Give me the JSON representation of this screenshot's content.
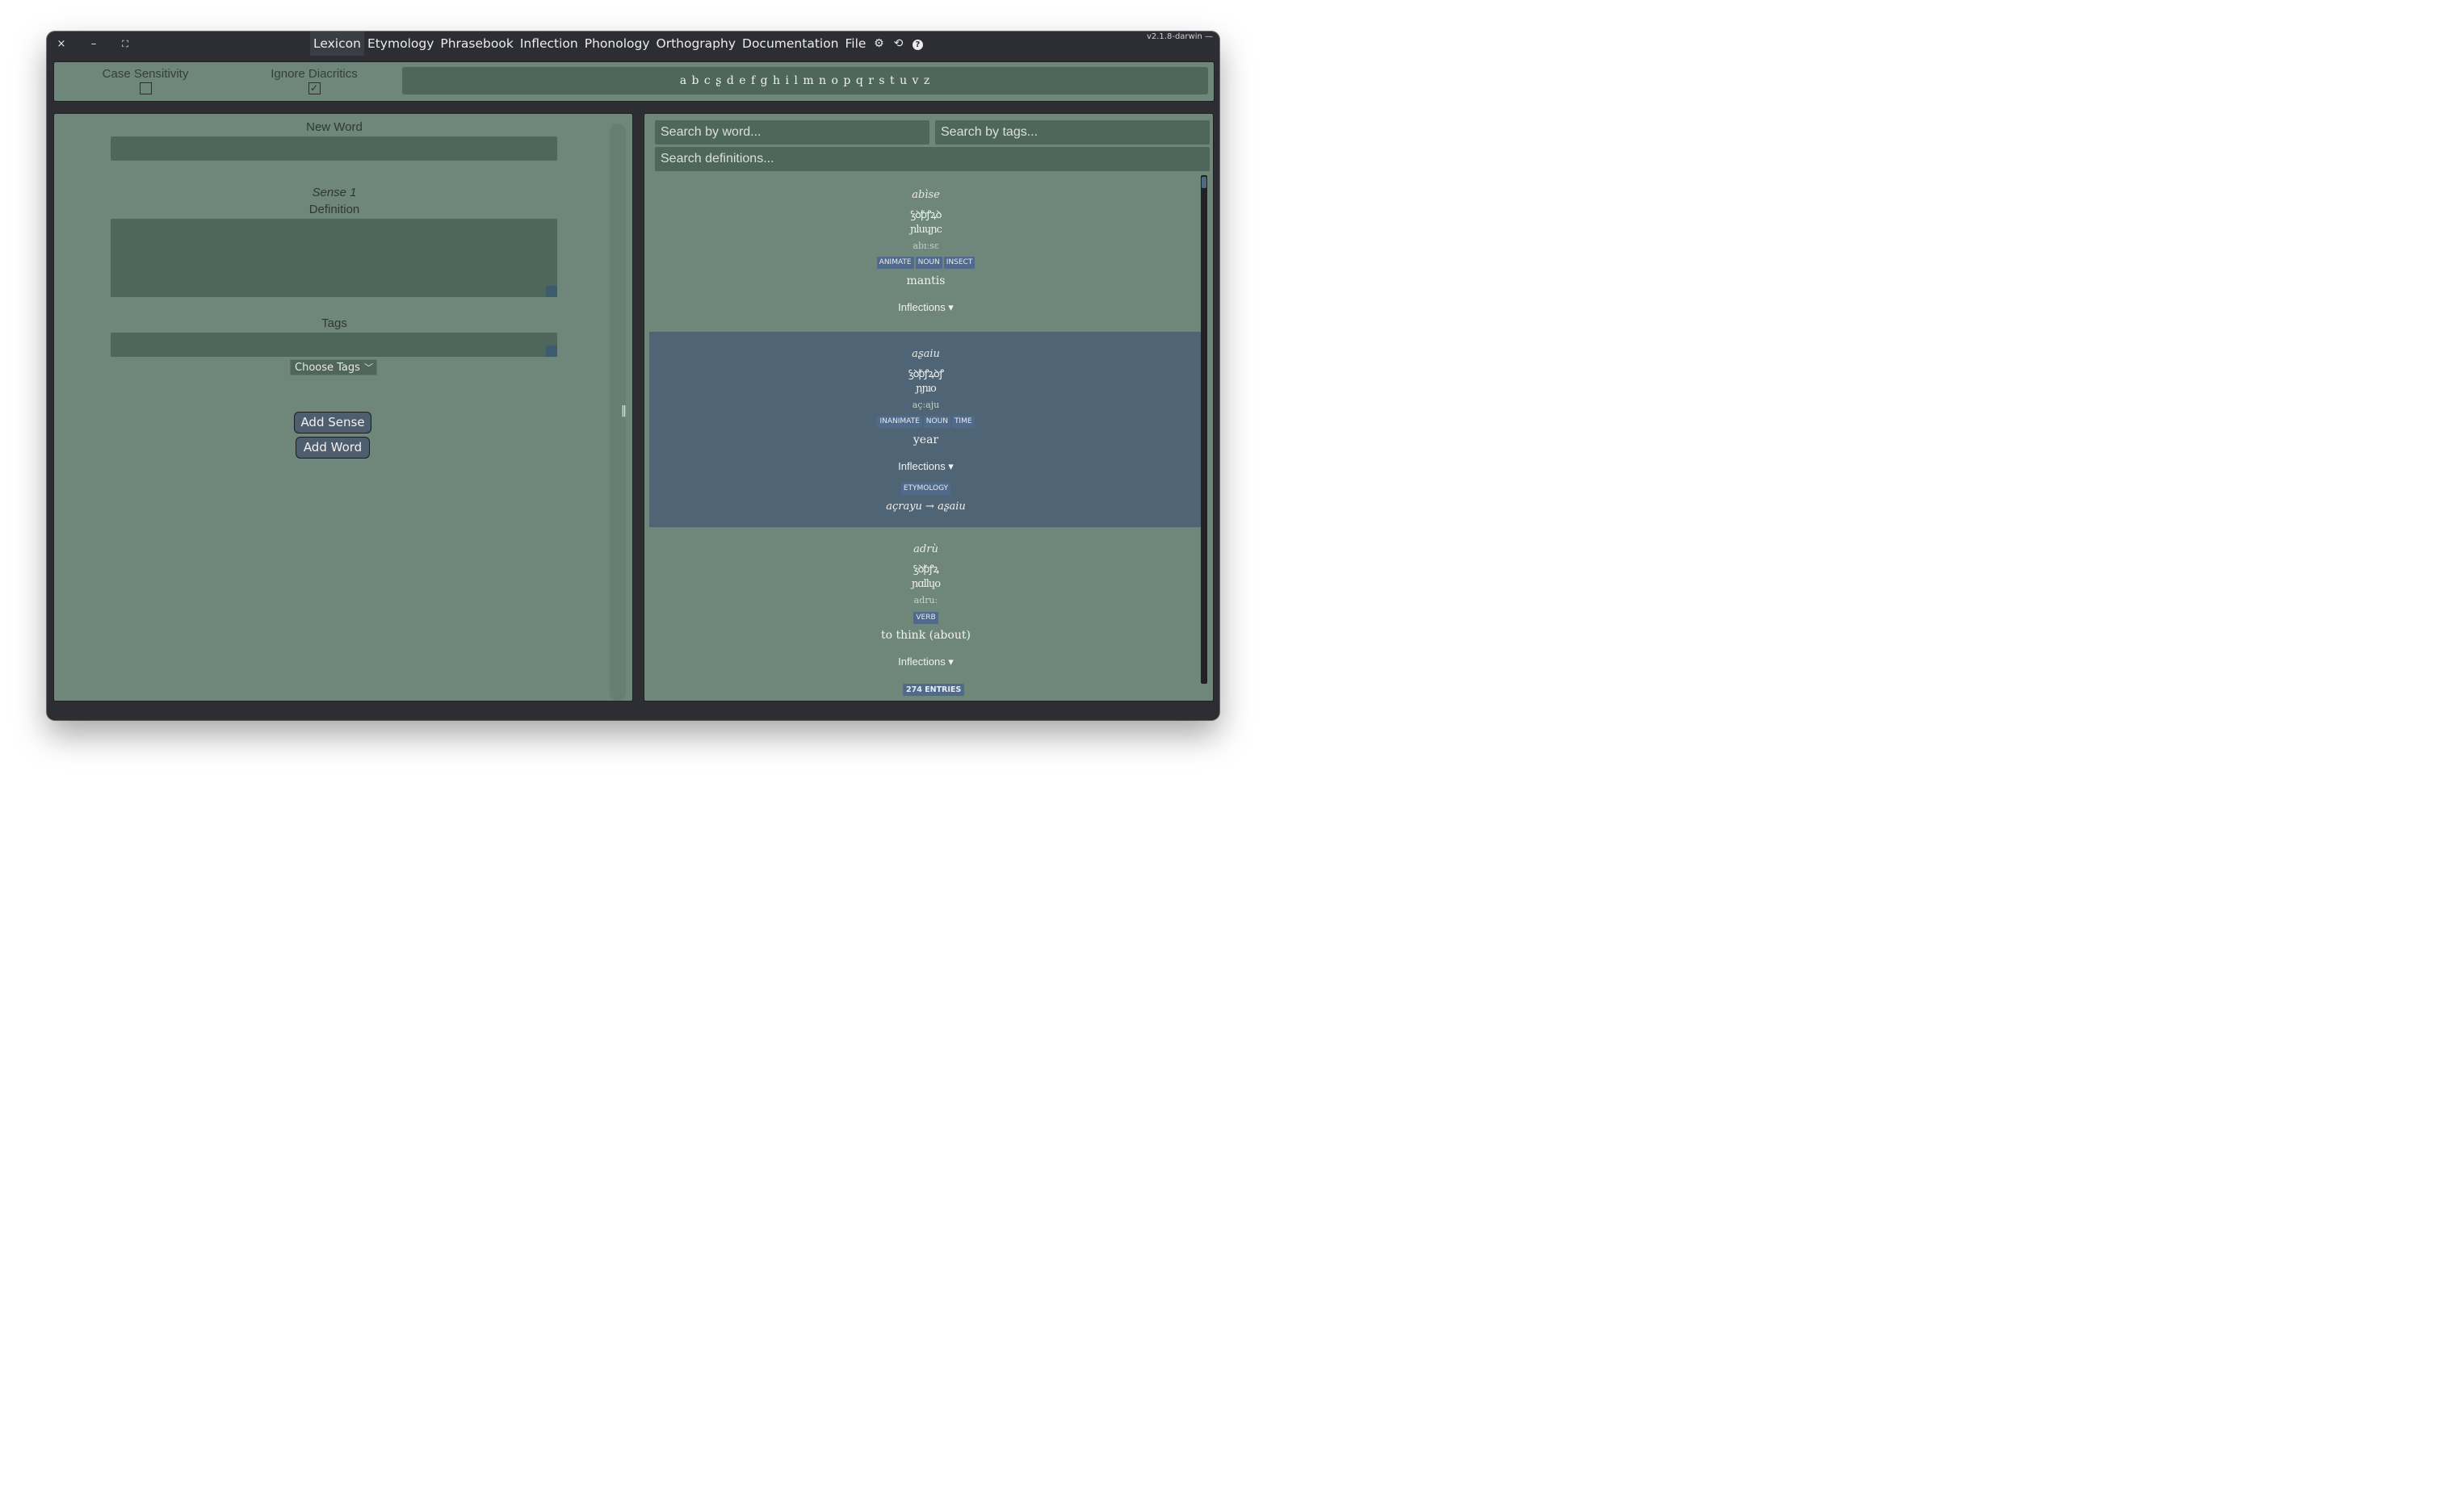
{
  "window": {
    "close_icon": "×",
    "minimize_icon": "–",
    "maximize_icon": "⛶",
    "version": "v2.1.8-darwin —"
  },
  "menu": {
    "items": [
      "Lexicon",
      "Etymology",
      "Phrasebook",
      "Inflection",
      "Phonology",
      "Orthography",
      "Documentation",
      "File"
    ],
    "active": "Lexicon",
    "settings_icon": "⚙",
    "history_icon": "⟲",
    "help_icon": "?"
  },
  "toolbar": {
    "case_sensitivity_label": "Case Sensitivity",
    "case_sensitivity_checked": false,
    "ignore_diacritics_label": "Ignore Diacritics",
    "ignore_diacritics_checked": true,
    "check_glyph": "✓",
    "alphabet": "a b c ʂ d e f g h i l m n o p q r s t u v z"
  },
  "editor": {
    "new_word_label": "New Word",
    "sense_label": "Sense 1",
    "definition_label": "Definition",
    "tags_label": "Tags",
    "choose_tags": "Choose Tags",
    "add_sense_button": "Add Sense",
    "add_word_button": "Add Word",
    "divider_handle": "‖"
  },
  "search": {
    "word_placeholder": "Search by word...",
    "tags_placeholder": "Search by tags...",
    "definitions_placeholder": "Search definitions..."
  },
  "entries": [
    {
      "word": "abìse",
      "script": "ꝣꝺꝥꝭꝝꝺ",
      "romanized": "ɲluɥɲc",
      "ipa": "abɪːsɛ",
      "tags": [
        "ANIMATE",
        "NOUN",
        "INSECT"
      ],
      "definition": "mantis",
      "inflections_label": "Inflections ▾",
      "selected": false
    },
    {
      "word": "aʂaiu",
      "script": "ꝣꝺꝥꝭꝝꝺꝭ",
      "romanized": "ɲɲıo",
      "ipa": "aç:aju",
      "tags": [
        "INANIMATE",
        "NOUN",
        "TIME"
      ],
      "definition": "year",
      "inflections_label": "Inflections ▾",
      "etymology_tag": "ETYMOLOGY",
      "etymology": "açrayu → aʂaiu",
      "selected": true
    },
    {
      "word": "adrù",
      "script": "ꝣꝺꝥꝭꝝ",
      "romanized": "ɲɑllɥo",
      "ipa": "adruː",
      "tags": [
        "VERB"
      ],
      "definition": "to think (about)",
      "inflections_label": "Inflections ▾",
      "selected": false
    }
  ],
  "entry_count": "274 ENTRIES"
}
